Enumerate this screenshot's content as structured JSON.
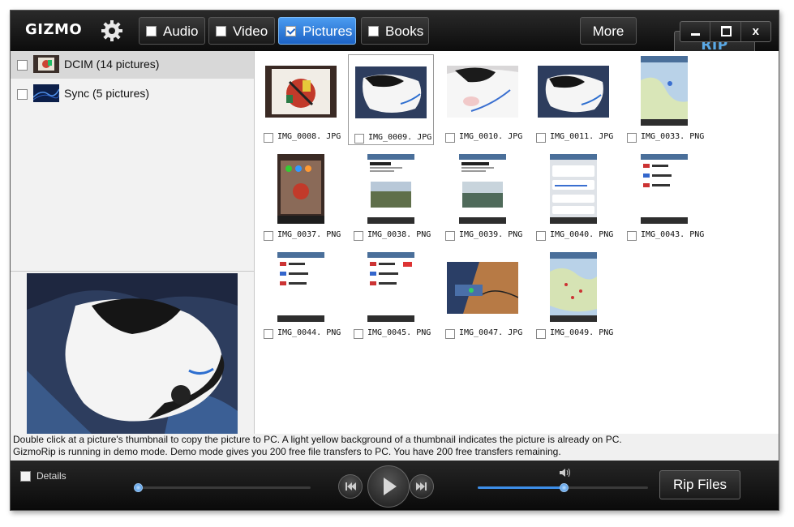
{
  "logo": {
    "part1": "GIZMO",
    "part2": "RIP"
  },
  "tabs": [
    {
      "label": "Audio",
      "checked": false
    },
    {
      "label": "Video",
      "checked": false
    },
    {
      "label": "Pictures",
      "checked": true
    },
    {
      "label": "Books",
      "checked": false
    }
  ],
  "more_label": "More",
  "window_controls": {
    "close": "x"
  },
  "albums": [
    {
      "label": "DCIM (14 pictures)",
      "selected": true
    },
    {
      "label": "Sync (5 pictures)",
      "selected": false
    }
  ],
  "pictures": [
    {
      "name": "IMG_0008. JPG",
      "selected": false
    },
    {
      "name": "IMG_0009. JPG",
      "selected": true
    },
    {
      "name": "IMG_0010. JPG",
      "selected": false
    },
    {
      "name": "IMG_0011. JPG",
      "selected": false
    },
    {
      "name": "IMG_0033. PNG",
      "selected": false
    },
    {
      "name": "IMG_0037. PNG",
      "selected": false
    },
    {
      "name": "IMG_0038. PNG",
      "selected": false
    },
    {
      "name": "IMG_0039. PNG",
      "selected": false
    },
    {
      "name": "IMG_0040. PNG",
      "selected": false
    },
    {
      "name": "IMG_0043. PNG",
      "selected": false
    },
    {
      "name": "IMG_0044. PNG",
      "selected": false
    },
    {
      "name": "IMG_0045. PNG",
      "selected": false
    },
    {
      "name": "IMG_0047. JPG",
      "selected": false
    },
    {
      "name": "IMG_0049. PNG",
      "selected": false
    }
  ],
  "status": {
    "line1": "Double click at a picture's thumbnail to copy the picture to PC.  A light yellow background of a thumbnail indicates the picture is already on PC.",
    "line2": "GizmoRip is running in demo mode.  Demo mode gives you 200 free file transfers to PC.  You have 200 free transfers remaining."
  },
  "bottom": {
    "details_label": "Details",
    "rip_label": "Rip Files",
    "progress_fraction": 0.0,
    "volume_fraction": 0.5
  },
  "colors": {
    "accent": "#3d8ee8",
    "rip_logo": "#5aa9e6"
  }
}
